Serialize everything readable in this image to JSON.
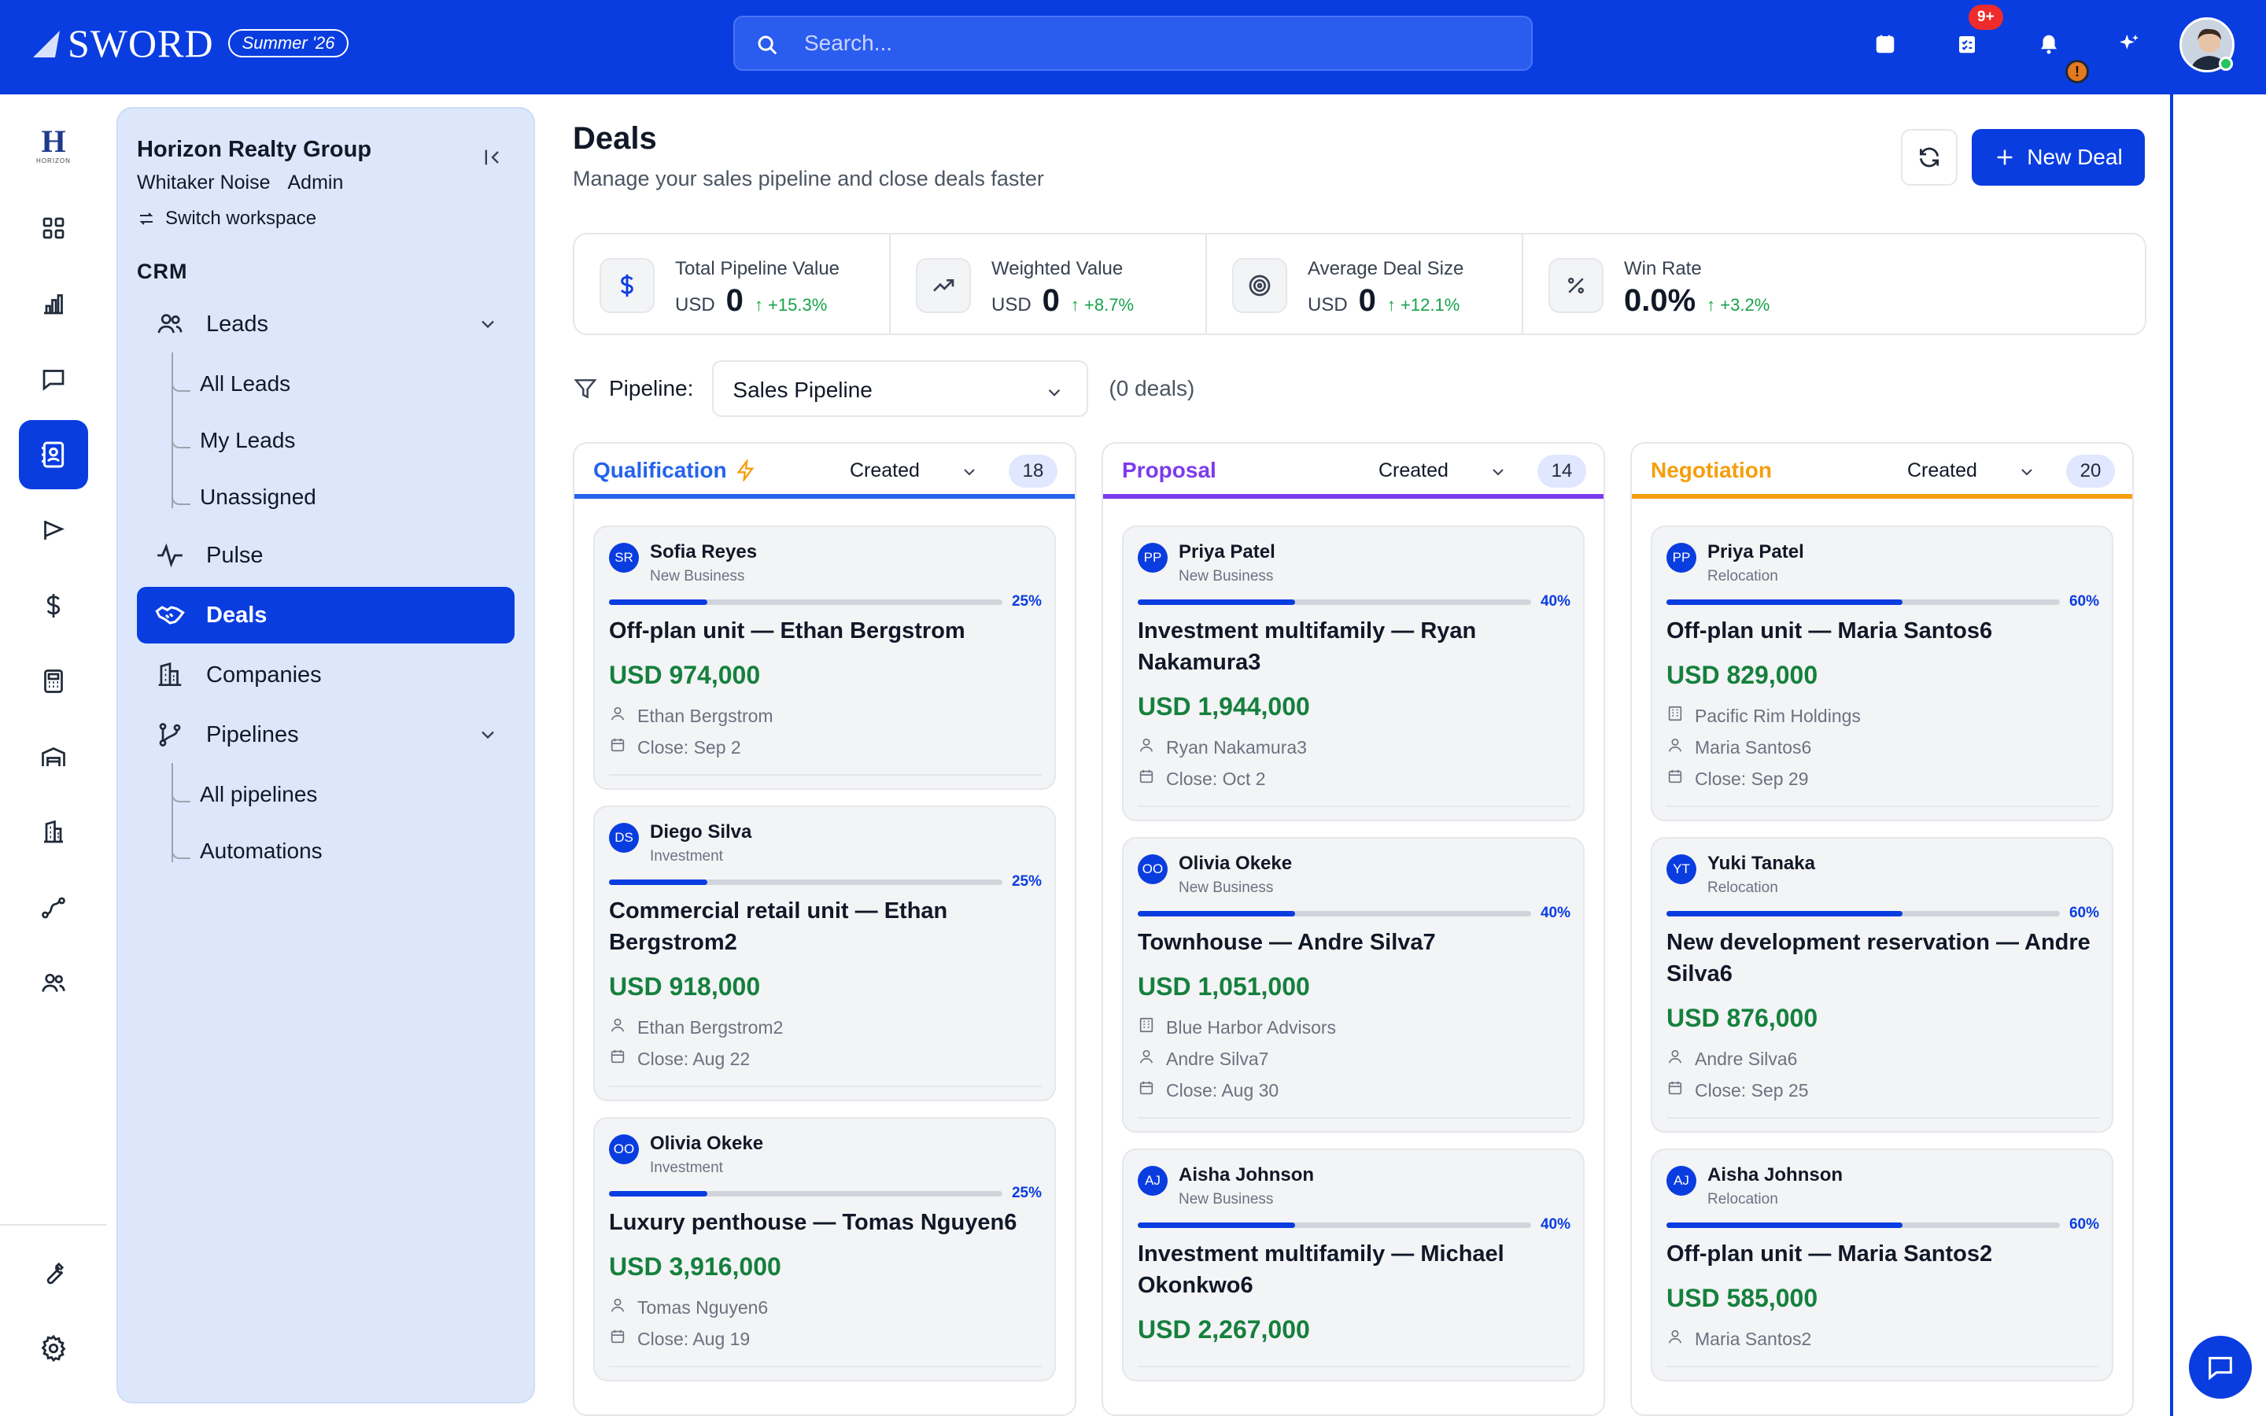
{
  "brand": {
    "name": "SWORD",
    "edition": "Summer '26"
  },
  "search": {
    "placeholder": "Search..."
  },
  "topbar": {
    "tasks_badge": "9+",
    "notif_badge": "!"
  },
  "rail": {
    "logo_text": "H",
    "logo_sub": "HORIZON",
    "items": [
      "dashboard-icon",
      "chart-icon",
      "chat-icon",
      "contacts-icon",
      "campaign-icon",
      "dollar-icon",
      "calculator-icon",
      "warehouse-icon",
      "building-icon",
      "route-icon",
      "team-icon"
    ],
    "bottom": [
      "wrench-icon",
      "settings-icon"
    ]
  },
  "sidebar": {
    "workspace": "Horizon Realty Group",
    "user": "Whitaker Noise",
    "role": "Admin",
    "switch_label": "Switch workspace",
    "section": "CRM",
    "leads": "Leads",
    "leads_sub": [
      "All Leads",
      "My Leads",
      "Unassigned"
    ],
    "pulse": "Pulse",
    "deals": "Deals",
    "companies": "Companies",
    "pipelines": "Pipelines",
    "pipelines_sub": [
      "All pipelines",
      "Automations"
    ]
  },
  "page": {
    "title": "Deals",
    "subtitle": "Manage your sales pipeline and close deals faster",
    "new_deal": "New Deal"
  },
  "stats": [
    {
      "label": "Total Pipeline Value",
      "currency": "USD",
      "value": "0",
      "delta": "+15.3%"
    },
    {
      "label": "Weighted Value",
      "currency": "USD",
      "value": "0",
      "delta": "+8.7%"
    },
    {
      "label": "Average Deal Size",
      "currency": "USD",
      "value": "0",
      "delta": "+12.1%"
    },
    {
      "label": "Win Rate",
      "currency": "",
      "value": "0.0%",
      "delta": "+3.2%"
    }
  ],
  "filter": {
    "label": "Pipeline:",
    "selected": "Sales Pipeline",
    "count": "(0 deals)"
  },
  "colors": {
    "primary": "#0a3de0",
    "qualification": "#2563eb",
    "proposal": "#7c3aed",
    "negotiation": "#f59e0b",
    "amount": "#15803d"
  },
  "columns": [
    {
      "name": "Qualification",
      "sort": "Created",
      "count": "18",
      "cards": [
        {
          "initials": "SR",
          "owner": "Sofia Reyes",
          "type": "New Business",
          "progress": 0.25,
          "pct": "25%",
          "title": "Off-plan unit — Ethan Bergstrom",
          "amount": "USD 974,000",
          "company": "",
          "contact": "Ethan Bergstrom",
          "close": "Close: Sep 2"
        },
        {
          "initials": "DS",
          "owner": "Diego Silva",
          "type": "Investment",
          "progress": 0.25,
          "pct": "25%",
          "title": "Commercial retail unit — Ethan Bergstrom2",
          "amount": "USD 918,000",
          "company": "",
          "contact": "Ethan Bergstrom2",
          "close": "Close: Aug 22"
        },
        {
          "initials": "OO",
          "owner": "Olivia Okeke",
          "type": "Investment",
          "progress": 0.25,
          "pct": "25%",
          "title": "Luxury penthouse — Tomas Nguyen6",
          "amount": "USD 3,916,000",
          "company": "",
          "contact": "Tomas Nguyen6",
          "close": "Close: Aug 19"
        }
      ]
    },
    {
      "name": "Proposal",
      "sort": "Created",
      "count": "14",
      "cards": [
        {
          "initials": "PP",
          "owner": "Priya Patel",
          "type": "New Business",
          "progress": 0.4,
          "pct": "40%",
          "title": "Investment multifamily — Ryan Nakamura3",
          "amount": "USD 1,944,000",
          "company": "",
          "contact": "Ryan Nakamura3",
          "close": "Close: Oct 2"
        },
        {
          "initials": "OO",
          "owner": "Olivia Okeke",
          "type": "New Business",
          "progress": 0.4,
          "pct": "40%",
          "title": "Townhouse — Andre Silva7",
          "amount": "USD 1,051,000",
          "company": "Blue Harbor Advisors",
          "contact": "Andre Silva7",
          "close": "Close: Aug 30"
        },
        {
          "initials": "AJ",
          "owner": "Aisha Johnson",
          "type": "New Business",
          "progress": 0.4,
          "pct": "40%",
          "title": "Investment multifamily — Michael Okonkwo6",
          "amount": "USD 2,267,000",
          "company": "",
          "contact": "",
          "close": ""
        }
      ]
    },
    {
      "name": "Negotiation",
      "sort": "Created",
      "count": "20",
      "cards": [
        {
          "initials": "PP",
          "owner": "Priya Patel",
          "type": "Relocation",
          "progress": 0.6,
          "pct": "60%",
          "title": "Off-plan unit — Maria Santos6",
          "amount": "USD 829,000",
          "company": "Pacific Rim Holdings",
          "contact": "Maria Santos6",
          "close": "Close: Sep 29"
        },
        {
          "initials": "YT",
          "owner": "Yuki Tanaka",
          "type": "Relocation",
          "progress": 0.6,
          "pct": "60%",
          "title": "New development reservation — Andre Silva6",
          "amount": "USD 876,000",
          "company": "",
          "contact": "Andre Silva6",
          "close": "Close: Sep 25"
        },
        {
          "initials": "AJ",
          "owner": "Aisha Johnson",
          "type": "Relocation",
          "progress": 0.6,
          "pct": "60%",
          "title": "Off-plan unit — Maria Santos2",
          "amount": "USD 585,000",
          "company": "",
          "contact": "Maria Santos2",
          "close": ""
        }
      ]
    }
  ]
}
